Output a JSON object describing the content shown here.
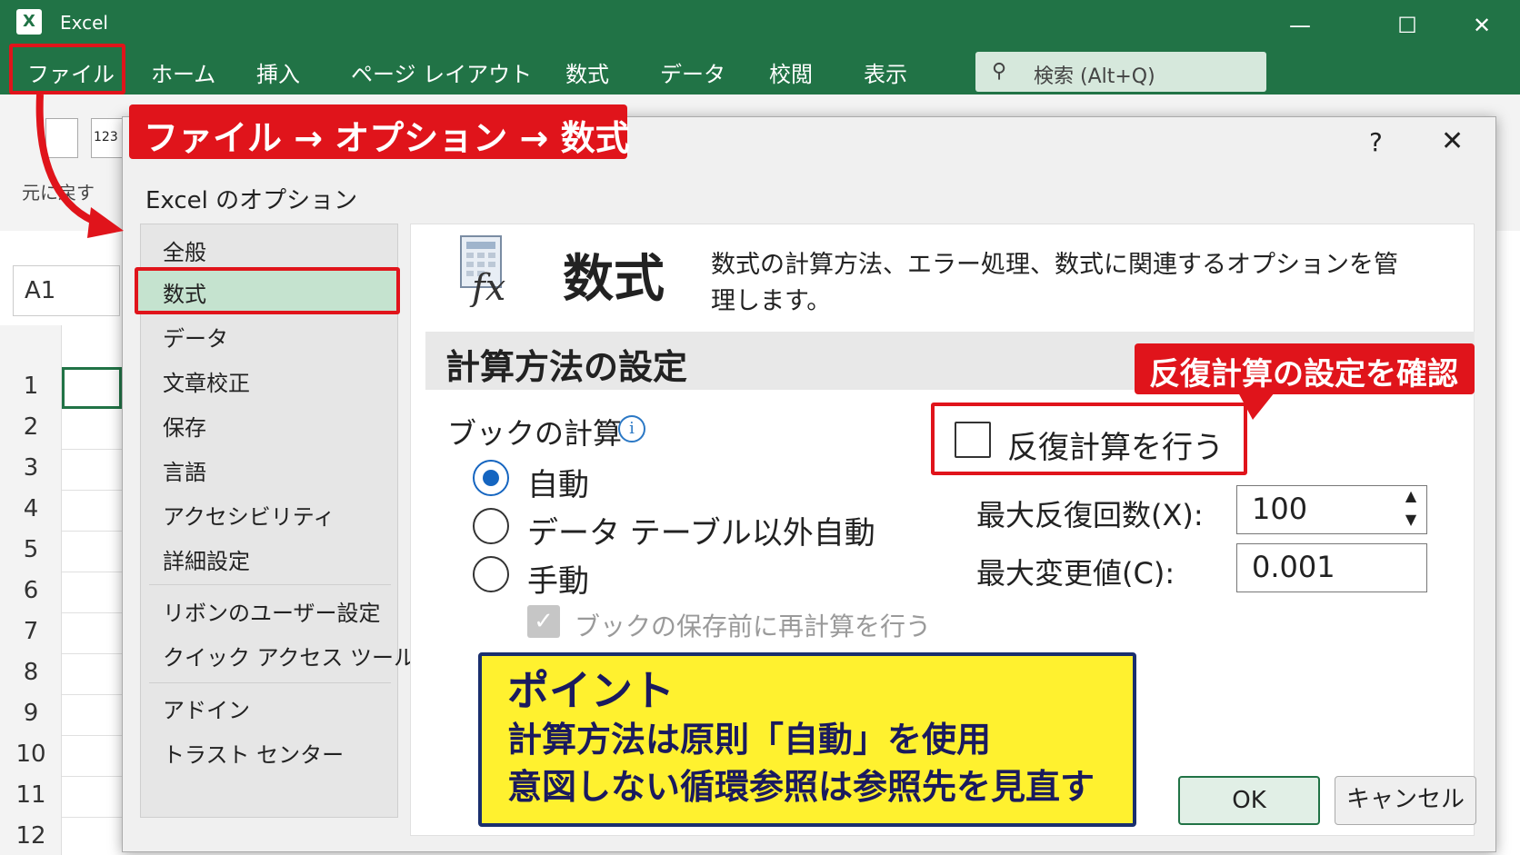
{
  "window": {
    "app_title": "Excel",
    "logo": "X",
    "controls": {
      "minimize": "—",
      "maximize": "☐",
      "close": "✕"
    }
  },
  "menu": {
    "items": [
      "ファイル",
      "ホーム",
      "挿入",
      "ページ レイアウト",
      "数式",
      "データ",
      "校閲",
      "表示"
    ],
    "search_placeholder": "検索 (Alt+Q)"
  },
  "ribbon": {
    "undo_label": "元に戻す",
    "icon_text": "123"
  },
  "namebox": "A1",
  "rows": [
    "1",
    "2",
    "3",
    "4",
    "5",
    "6",
    "7",
    "8",
    "9",
    "10",
    "11",
    "12"
  ],
  "dialog": {
    "title": "Excel のオプション",
    "help": "?",
    "close": "✕",
    "nav": [
      "全般",
      "数式",
      "データ",
      "文章校正",
      "保存",
      "言語",
      "アクセシビリティ",
      "詳細設定",
      "リボンのユーザー設定",
      "クイック アクセス ツール バー",
      "アドイン",
      "トラスト センター"
    ],
    "selected_nav": "数式",
    "heading": "数式",
    "description": "数式の計算方法、エラー処理、数式に関連するオプションを管理します。",
    "section_title": "計算方法の設定",
    "book_calc_label": "ブックの計算",
    "info": "i",
    "radio_options": [
      "自動",
      "データ テーブル以外自動",
      "手動"
    ],
    "selected_radio": "自動",
    "save_recalc_label": "ブックの保存前に再計算を行う",
    "save_recalc_checked": true,
    "iterative_label": "反復計算を行う",
    "iterative_checked": false,
    "max_iterations_label": "最大反復回数(X):",
    "max_iterations_value": "100",
    "max_change_label": "最大変更値(C):",
    "max_change_value": "0.001",
    "ok": "OK",
    "cancel": "キャンセル"
  },
  "annotations": {
    "path_banner": "ファイル → オプション → 数式",
    "iterative_banner": "反復計算の設定を確認",
    "point_title": "ポイント",
    "point_line1": "計算方法は原則「自動」を使用",
    "point_line2": "意図しない循環参照は参照先を見直す"
  },
  "colors": {
    "excel_green": "#217346",
    "annotation_red": "#e0141b",
    "note_yellow": "#fff12f",
    "note_navy": "#1a2f6e",
    "selection_green": "#c5e3cf",
    "radio_blue": "#1565c0"
  }
}
